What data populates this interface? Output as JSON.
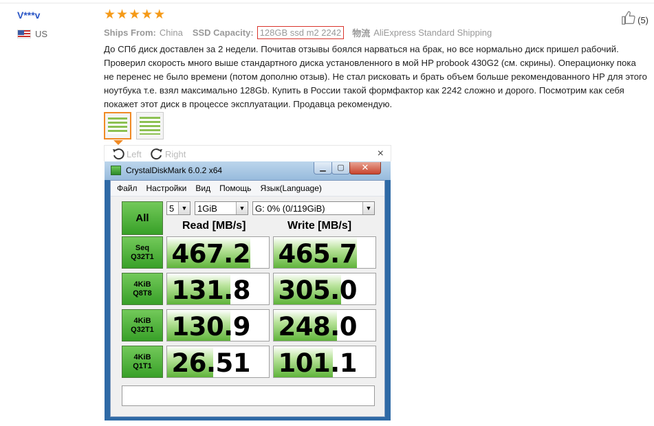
{
  "review": {
    "user_name": "V***v",
    "country": "US",
    "rating": 5,
    "helpful_count": "(5)",
    "attributes": [
      {
        "label": "Ships From:",
        "value": "China",
        "highlight": false
      },
      {
        "label": "SSD Capacity:",
        "value": "128GB ssd m2 2242",
        "highlight": true
      },
      {
        "label": "物流",
        "value": "AliExpress Standard Shipping",
        "highlight": false
      }
    ],
    "text": "До СПб диск доставлен за 2 недели. Почитав отзывы боялся нарваться на брак, но все нормально диск пришел рабочий. Проверил скорость много выше стандартного диска установленного в мой HP probook 430G2 (см. скрины). Операционку пока не перенес не было времени (потом дополню отзыв). Не стал рисковать и брать объем больше рекомендованного HP для этого ноутбука т.е. взял максимально 128Gb. Купить в России такой формфактор как 2242 сложно и дорого. Посмотрим как себя покажет этот диск в процессе эксплуатации. Продавца рекомендую."
  },
  "viewer": {
    "rotate_left": "Left",
    "rotate_right": "Right",
    "close": "×"
  },
  "cdm": {
    "title": "CrystalDiskMark 6.0.2 x64",
    "menu": [
      "Файл",
      "Настройки",
      "Вид",
      "Помощь",
      "Язык(Language)"
    ],
    "all_button": "All",
    "count": "5",
    "size": "1GiB",
    "drive": "G: 0% (0/119GiB)",
    "read_header": "Read [MB/s]",
    "write_header": "Write [MB/s]",
    "tests": [
      {
        "line1": "Seq",
        "line2": "Q32T1",
        "read": "467.2",
        "write": "465.7",
        "read_fill": 0.82,
        "write_fill": 0.82
      },
      {
        "line1": "4KiB",
        "line2": "Q8T8",
        "read": "131.8",
        "write": "305.0",
        "read_fill": 0.62,
        "write_fill": 0.66
      },
      {
        "line1": "4KiB",
        "line2": "Q32T1",
        "read": "130.9",
        "write": "248.0",
        "read_fill": 0.62,
        "write_fill": 0.62
      },
      {
        "line1": "4KiB",
        "line2": "Q1T1",
        "read": "26.51",
        "write": "101.1",
        "read_fill": 0.45,
        "write_fill": 0.58
      }
    ],
    "colors": {
      "accent_green": "#5fb43a",
      "title_bar": "#97bbdc"
    }
  }
}
